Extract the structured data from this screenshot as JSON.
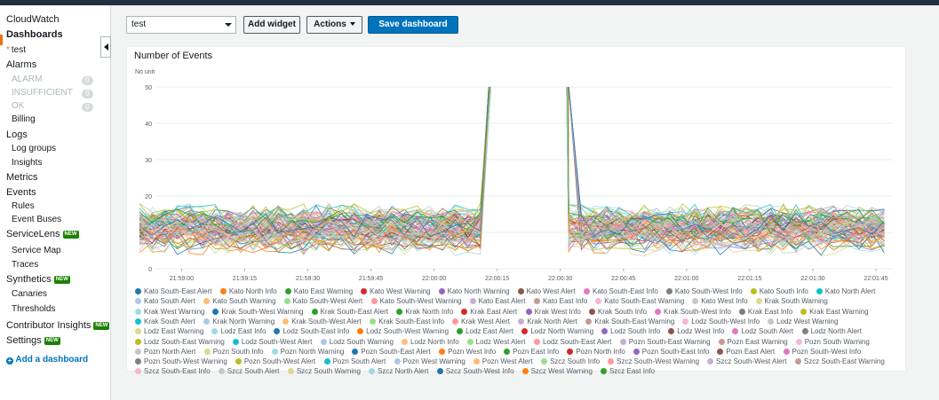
{
  "sidebar": {
    "items": [
      {
        "label": "CloudWatch",
        "type": "item"
      },
      {
        "label": "Dashboards",
        "type": "item",
        "active": true
      },
      {
        "label": "test",
        "type": "sub",
        "prefix": "*"
      },
      {
        "label": "Alarms",
        "type": "item"
      },
      {
        "label": "ALARM",
        "type": "sub",
        "dim": true,
        "count": "0"
      },
      {
        "label": "INSUFFICIENT",
        "type": "sub",
        "dim": true,
        "count": "0"
      },
      {
        "label": "OK",
        "type": "sub",
        "dim": true,
        "count": "0"
      },
      {
        "label": "Billing",
        "type": "sub"
      },
      {
        "label": "Logs",
        "type": "item"
      },
      {
        "label": "Log groups",
        "type": "sub"
      },
      {
        "label": "Insights",
        "type": "sub"
      },
      {
        "label": "Metrics",
        "type": "item"
      },
      {
        "label": "Events",
        "type": "item"
      },
      {
        "label": "Rules",
        "type": "sub"
      },
      {
        "label": "Event Buses",
        "type": "sub"
      },
      {
        "label": "ServiceLens",
        "type": "item",
        "badge": "NEW"
      },
      {
        "label": "Service Map",
        "type": "sub"
      },
      {
        "label": "Traces",
        "type": "sub"
      },
      {
        "label": "Synthetics",
        "type": "item",
        "badge": "NEW"
      },
      {
        "label": "Canaries",
        "type": "sub"
      },
      {
        "label": "Thresholds",
        "type": "sub"
      },
      {
        "label": "Contributor Insights",
        "type": "item",
        "badge": "NEW"
      },
      {
        "label": "Settings",
        "type": "item",
        "badge": "NEW"
      }
    ],
    "add_dashboard": "Add a dashboard"
  },
  "toolbar": {
    "dashboard_select": "test",
    "add_widget": "Add widget",
    "actions": "Actions",
    "save_dashboard": "Save dashboard"
  },
  "widget": {
    "title": "Number of Events"
  },
  "chart_data": {
    "type": "line",
    "title": "Number of Events",
    "ylabel": "No unit",
    "ylim": [
      0,
      50
    ],
    "yticks": [
      0,
      10,
      20,
      30,
      40,
      50
    ],
    "xticks": [
      "21:59:00",
      "21:59:15",
      "21:59:30",
      "21:59:45",
      "22:00:00",
      "22:00:15",
      "22:00:30",
      "22:00:45",
      "22:01:00",
      "22:01:15",
      "22:01:30",
      "22:01:45"
    ],
    "x_start": "21:58:50",
    "x_end": "22:01:49",
    "x_step_seconds": 3,
    "spike": {
      "rise": "22:00:13",
      "peak_start": "22:00:14",
      "peak_end": "22:00:31",
      "peak_value": 50,
      "fall": "22:00:32"
    },
    "value_band": [
      3,
      19
    ],
    "legend_position": "bottom",
    "series": [
      {
        "name": "Kato South-East Alert",
        "color": "#1f77b4"
      },
      {
        "name": "Kato North Info",
        "color": "#ff7f0e"
      },
      {
        "name": "Kato East Warning",
        "color": "#2ca02c"
      },
      {
        "name": "Kato West Warning",
        "color": "#d62728"
      },
      {
        "name": "Kato North Warning",
        "color": "#9467bd"
      },
      {
        "name": "Kato West Alert",
        "color": "#8c564b"
      },
      {
        "name": "Kato South-East Info",
        "color": "#e377c2"
      },
      {
        "name": "Kato South-West Info",
        "color": "#7f7f7f"
      },
      {
        "name": "Kato South Info",
        "color": "#bcbd22"
      },
      {
        "name": "Kato North Alert",
        "color": "#17becf"
      },
      {
        "name": "Kato South Alert",
        "color": "#aec7e8"
      },
      {
        "name": "Kato South Warning",
        "color": "#ffbb78"
      },
      {
        "name": "Kato South-West Alert",
        "color": "#98df8a"
      },
      {
        "name": "Kato South-West Warning",
        "color": "#ff9896"
      },
      {
        "name": "Kato East Alert",
        "color": "#c5b0d5"
      },
      {
        "name": "Kato East Info",
        "color": "#c49c94"
      },
      {
        "name": "Kato South-East Warning",
        "color": "#f7b6d2"
      },
      {
        "name": "Kato West Info",
        "color": "#c7c7c7"
      },
      {
        "name": "Krak South Warning",
        "color": "#dbdb8d"
      },
      {
        "name": "Krak West Warning",
        "color": "#9edae5"
      },
      {
        "name": "Krak South-West Warning",
        "color": "#1f77b4"
      },
      {
        "name": "Krak South-East Alert",
        "color": "#2ca02c"
      },
      {
        "name": "Krak North Info",
        "color": "#2ca02c"
      },
      {
        "name": "Krak East Alert",
        "color": "#d62728"
      },
      {
        "name": "Krak West Info",
        "color": "#9467bd"
      },
      {
        "name": "Krak South Info",
        "color": "#8c564b"
      },
      {
        "name": "Krak South-West Info",
        "color": "#e377c2"
      },
      {
        "name": "Krak East Info",
        "color": "#7f7f7f"
      },
      {
        "name": "Krak East Warning",
        "color": "#bcbd22"
      },
      {
        "name": "Krak South Alert",
        "color": "#17becf"
      },
      {
        "name": "Krak North Warning",
        "color": "#aec7e8"
      },
      {
        "name": "Krak South-West Alert",
        "color": "#ffbb78"
      },
      {
        "name": "Krak South-East Info",
        "color": "#98df8a"
      },
      {
        "name": "Krak West Alert",
        "color": "#ff9896"
      },
      {
        "name": "Krak North Alert",
        "color": "#c5b0d5"
      },
      {
        "name": "Krak South-East Warning",
        "color": "#c49c94"
      },
      {
        "name": "Lodz South-West Info",
        "color": "#f7b6d2"
      },
      {
        "name": "Lodz West Warning",
        "color": "#c7c7c7"
      },
      {
        "name": "Lodz East Warning",
        "color": "#dbdb8d"
      },
      {
        "name": "Lodz East Info",
        "color": "#9edae5"
      },
      {
        "name": "Lodz South-East Info",
        "color": "#1f77b4"
      },
      {
        "name": "Lodz South-West Warning",
        "color": "#ff7f0e"
      },
      {
        "name": "Lodz East Alert",
        "color": "#2ca02c"
      },
      {
        "name": "Lodz North Warning",
        "color": "#d62728"
      },
      {
        "name": "Lodz South Info",
        "color": "#9467bd"
      },
      {
        "name": "Lodz West Info",
        "color": "#8c564b"
      },
      {
        "name": "Lodz South Alert",
        "color": "#e377c2"
      },
      {
        "name": "Lodz North Alert",
        "color": "#7f7f7f"
      },
      {
        "name": "Lodz South-East Warning",
        "color": "#bcbd22"
      },
      {
        "name": "Lodz South-West Alert",
        "color": "#17becf"
      },
      {
        "name": "Lodz South Warning",
        "color": "#aec7e8"
      },
      {
        "name": "Lodz North Info",
        "color": "#ffbb78"
      },
      {
        "name": "Lodz West Alert",
        "color": "#98df8a"
      },
      {
        "name": "Lodz South-East Alert",
        "color": "#ff9896"
      },
      {
        "name": "Pozn South-East Warning",
        "color": "#c5b0d5"
      },
      {
        "name": "Pozn East Warning",
        "color": "#c49c94"
      },
      {
        "name": "Pozn South Warning",
        "color": "#f7b6d2"
      },
      {
        "name": "Pozn North Alert",
        "color": "#c7c7c7"
      },
      {
        "name": "Pozn South Info",
        "color": "#dbdb8d"
      },
      {
        "name": "Pozn North Warning",
        "color": "#9edae5"
      },
      {
        "name": "Pozn South-East Alert",
        "color": "#1f77b4"
      },
      {
        "name": "Pozn West Info",
        "color": "#ff7f0e"
      },
      {
        "name": "Pozn East Info",
        "color": "#2ca02c"
      },
      {
        "name": "Pozn North Info",
        "color": "#d62728"
      },
      {
        "name": "Pozn South-East Info",
        "color": "#9467bd"
      },
      {
        "name": "Pozn East Alert",
        "color": "#8c564b"
      },
      {
        "name": "Pozn South-West Info",
        "color": "#e377c2"
      },
      {
        "name": "Pozn South-West Warning",
        "color": "#7f7f7f"
      },
      {
        "name": "Pozn South-West Alert",
        "color": "#bcbd22"
      },
      {
        "name": "Pozn South Alert",
        "color": "#17becf"
      },
      {
        "name": "Pozn West Warning",
        "color": "#aec7e8"
      },
      {
        "name": "Pozn West Alert",
        "color": "#ffbb78"
      },
      {
        "name": "Szcz South Info",
        "color": "#98df8a"
      },
      {
        "name": "Szcz South-West Warning",
        "color": "#ff9896"
      },
      {
        "name": "Szcz South-West Alert",
        "color": "#c5b0d5"
      },
      {
        "name": "Szcz South-East Warning",
        "color": "#c49c94"
      },
      {
        "name": "Szcz South-East Info",
        "color": "#f7b6d2"
      },
      {
        "name": "Szcz South Alert",
        "color": "#c7c7c7"
      },
      {
        "name": "Szcz South Warning",
        "color": "#dbdb8d"
      },
      {
        "name": "Szcz North Alert",
        "color": "#9edae5"
      },
      {
        "name": "Szcz South-West Info",
        "color": "#1f77b4"
      },
      {
        "name": "Szcz West Warning",
        "color": "#ff7f0e"
      },
      {
        "name": "Szcz East Info",
        "color": "#2ca02c"
      }
    ]
  }
}
